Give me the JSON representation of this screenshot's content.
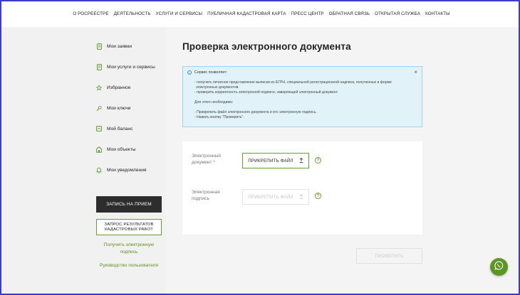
{
  "nav": [
    "О РОСРЕЕСТРЕ",
    "ДЕЯТЕЛЬНОСТЬ",
    "УСЛУГИ И СЕРВИСЫ",
    "ПУБЛИЧНАЯ КАДАСТРОВАЯ КАРТА",
    "ПРЕСС ЦЕНТР",
    "ОБРАТНАЯ СВЯЗЬ",
    "ОТКРЫТАЯ СЛУЖБА",
    "КОНТАКТЫ"
  ],
  "sidebar": {
    "items": [
      {
        "label": "Мои заявки",
        "icon": "document-icon"
      },
      {
        "label": "Мои услуги и сервисы",
        "icon": "services-icon"
      },
      {
        "label": "Избранное",
        "icon": "star-icon"
      },
      {
        "label": "Мои ключи",
        "icon": "key-icon"
      },
      {
        "label": "Мой баланс",
        "icon": "wallet-icon"
      },
      {
        "label": "Мои объекты",
        "icon": "house-icon"
      },
      {
        "label": "Мои уведомления",
        "icon": "bell-icon"
      }
    ],
    "appointment_button": "ЗАПИСЬ НА ПРИЕМ",
    "request_button_line1": "ЗАПРОС РЕЗУЛЬТАТОВ",
    "request_button_line2": "КАДАСТРОВЫХ РАБОТ",
    "signature_link_line1": "Получить электронную",
    "signature_link_line2": "подпись",
    "manual_link": "Руководство пользователя"
  },
  "main": {
    "title": "Проверка электронного документа",
    "info": {
      "heading": "Сервис позволяет:",
      "lines": [
        "- получить печатное представление выписки из ЕГРН, специальной регистрационной надписи, полученных в форме",
        "электронных документов.",
        "- проверить корректность электронной подписи, заверяющей электронный документ.",
        "Для этого необходимо:",
        "- Прикрепить файл электронного документа и его электронную подпись.",
        "- Нажать кнопку \"Проверить\"."
      ],
      "close": "×"
    },
    "doc_label_line1": "Электронный",
    "doc_label_line2": "документ",
    "required_mark": "*",
    "attach_label": "ПРИКРЕПИТЬ ФАЙЛ",
    "sig_label_line1": "Электронная",
    "sig_label_line2": "подпись",
    "help": "?",
    "check_button": "ПРОВЕРИТЬ"
  },
  "colors": {
    "accent": "#6b9d2e",
    "info_bg": "#e2f2f9",
    "info_border": "#9ed4ea",
    "dark_button": "#2d2d2d"
  }
}
